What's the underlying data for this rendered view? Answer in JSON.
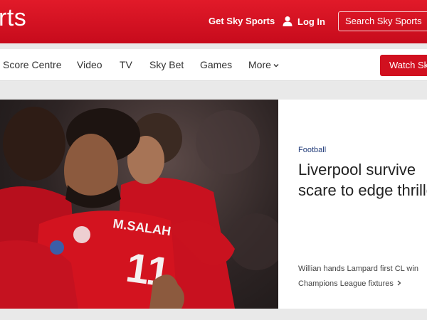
{
  "header": {
    "brand": "rts",
    "get_sky_sports": "Get Sky Sports",
    "login": "Log In",
    "search_placeholder": "Search Sky Sports"
  },
  "nav": {
    "items": [
      {
        "label": "Score Centre"
      },
      {
        "label": "Video"
      },
      {
        "label": "TV"
      },
      {
        "label": "Sky Bet"
      },
      {
        "label": "Games"
      },
      {
        "label": "More"
      }
    ],
    "watch_button": "Watch Sk"
  },
  "hero": {
    "category": "Football",
    "headline": "Liverpool survive scare to edge thriller",
    "related": "Willian hands Lampard first CL win",
    "fixtures_link": "Champions League fixtures"
  },
  "photo_text": {
    "shirt_name": "M.SALAH",
    "shirt_number": "11"
  },
  "colors": {
    "brand_red": "#d1101f",
    "category_blue": "#233d7a"
  },
  "icons": {
    "login": "user-icon",
    "more": "chevron-down-icon",
    "fixtures": "chevron-right-icon"
  }
}
